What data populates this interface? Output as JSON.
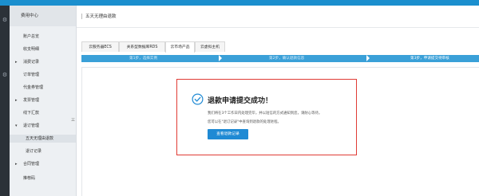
{
  "sidebar": {
    "header": "费用中心",
    "items": [
      {
        "label": "账户总览",
        "caret": ""
      },
      {
        "label": "收支明细",
        "caret": ""
      },
      {
        "label": "消费记录",
        "caret": "▸"
      },
      {
        "label": "订单管理",
        "caret": ""
      },
      {
        "label": "代金券管理",
        "caret": ""
      },
      {
        "label": "发票管理",
        "caret": "▸"
      },
      {
        "label": "线下汇款",
        "caret": ""
      },
      {
        "label": "退订管理",
        "caret": "▾"
      },
      {
        "label": "五天无理由退款",
        "caret": ""
      },
      {
        "label": "退订记录",
        "caret": ""
      },
      {
        "label": "合同管理",
        "caret": "▸"
      },
      {
        "label": "推荐码",
        "caret": ""
      }
    ],
    "collapse_glyph": "三"
  },
  "rail_icons": [
    "gear-icon",
    "gear-icon"
  ],
  "breadcrumb": "五天无理由退款",
  "tabs": [
    "云服务器ECS",
    "关系型数据库RDS",
    "云市场产品",
    "云虚拟主机"
  ],
  "steps": [
    "第1步，选择实例",
    "第2步，确认退款信息",
    "第3步，申请提交待审核"
  ],
  "success": {
    "title": "退款申请提交成功！",
    "desc1": "我们将在3个工作日内处理完毕，并以短信的方式通知到您，请耐心等待。",
    "desc2": "您可以在\"退订记录\"中查询到退款的处理进程。",
    "button": "查看退款记录"
  },
  "colors": {
    "accent": "#1b8fce",
    "highlight": "#e03b35",
    "step_bar": "#3aa0d8"
  }
}
